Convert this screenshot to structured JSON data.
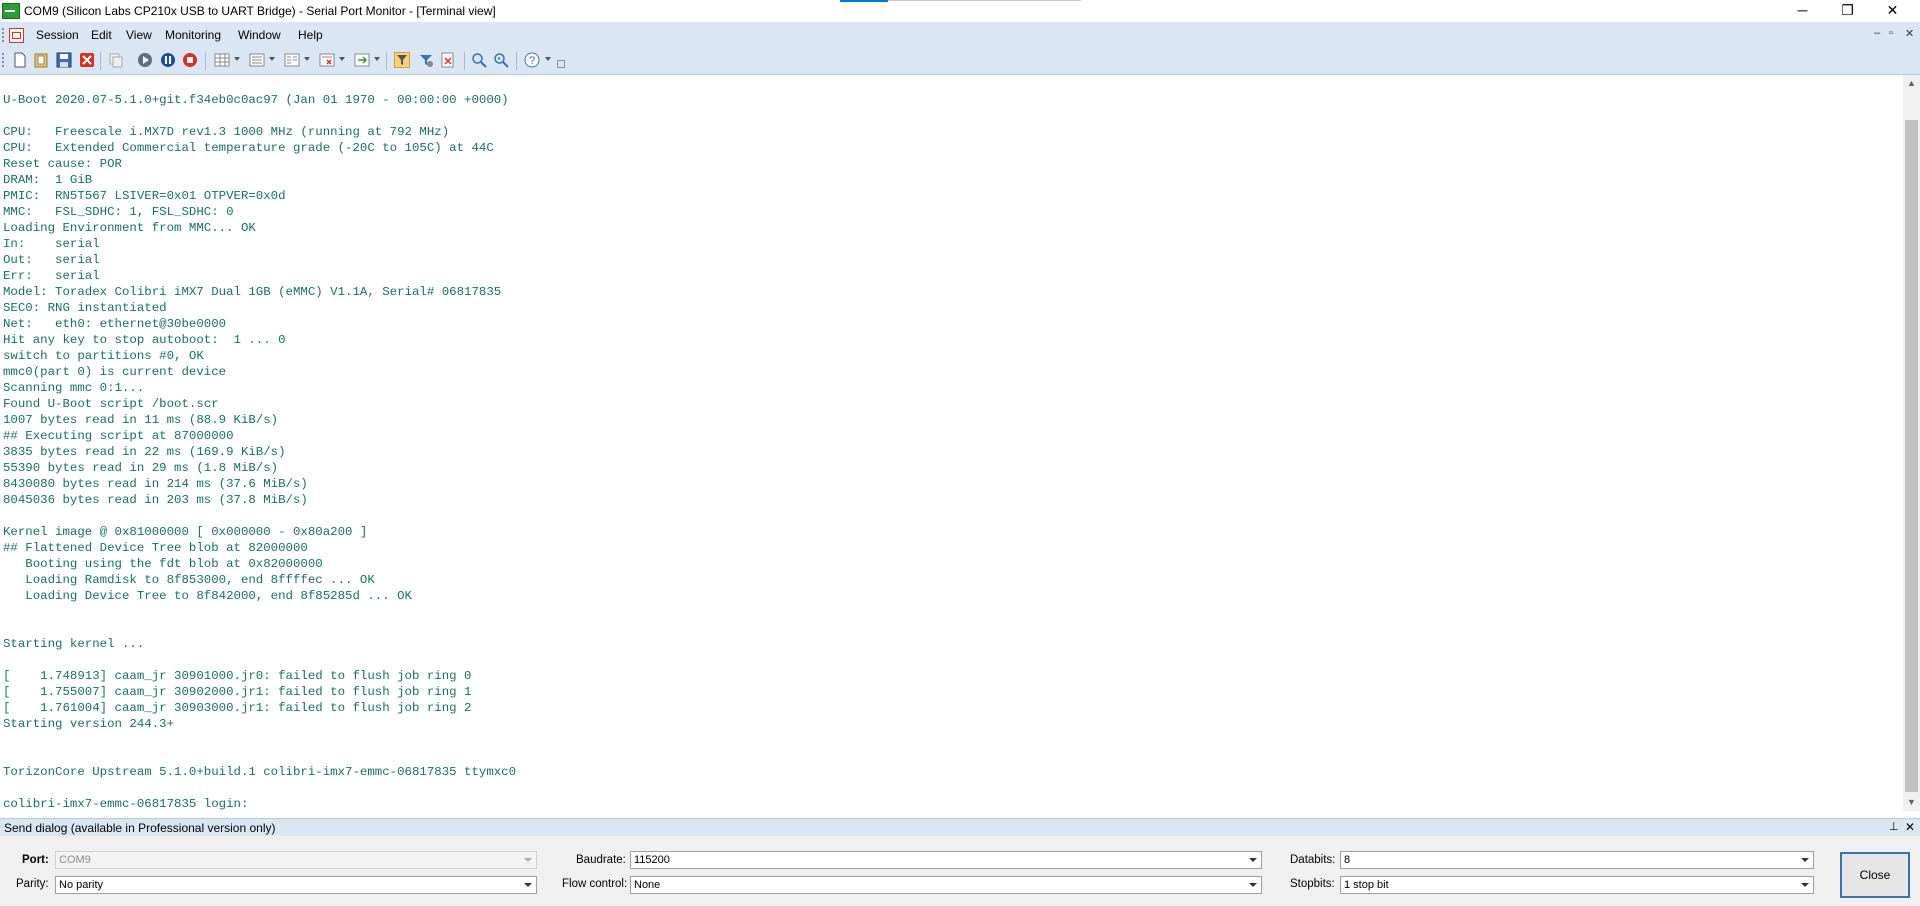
{
  "window": {
    "title": "COM9 (Silicon Labs CP210x USB to UART Bridge) - Serial Port Monitor - [Terminal view]",
    "controls": {
      "minimize": "─",
      "restore": "❐",
      "close": "✕"
    }
  },
  "menu": {
    "items": [
      "Session",
      "Edit",
      "View",
      "Monitoring",
      "Window",
      "Help"
    ],
    "mdi_controls": {
      "minimize": "‒",
      "restore": "▫",
      "close": "✕"
    }
  },
  "toolbar": {
    "buttons": [
      "new-session-icon",
      "open-session-icon",
      "save-icon",
      "close-session-icon",
      "copy-icon",
      "start-monitoring-icon",
      "pause-icon",
      "stop-icon",
      "table-view-icon",
      "line-view-icon",
      "dump-view-icon",
      "terminal-view-icon",
      "export-icon",
      "filter-icon",
      "settings-icon",
      "clear-icon",
      "find-icon",
      "find-next-icon",
      "help-icon"
    ]
  },
  "terminal": {
    "lines": [
      "U-Boot 2020.07-5.1.0+git.f34eb0c0ac97 (Jan 01 1970 - 00:00:00 +0000)",
      "",
      "CPU:   Freescale i.MX7D rev1.3 1000 MHz (running at 792 MHz)",
      "CPU:   Extended Commercial temperature grade (-20C to 105C) at 44C",
      "Reset cause: POR",
      "DRAM:  1 GiB",
      "PMIC:  RN5T567 LSIVER=0x01 OTPVER=0x0d",
      "MMC:   FSL_SDHC: 1, FSL_SDHC: 0",
      "Loading Environment from MMC... OK",
      "In:    serial",
      "Out:   serial",
      "Err:   serial",
      "Model: Toradex Colibri iMX7 Dual 1GB (eMMC) V1.1A, Serial# 06817835",
      "SEC0: RNG instantiated",
      "Net:   eth0: ethernet@30be0000",
      "Hit any key to stop autoboot:  1 ... 0",
      "switch to partitions #0, OK",
      "mmc0(part 0) is current device",
      "Scanning mmc 0:1...",
      "Found U-Boot script /boot.scr",
      "1007 bytes read in 11 ms (88.9 KiB/s)",
      "## Executing script at 87000000",
      "3835 bytes read in 22 ms (169.9 KiB/s)",
      "55390 bytes read in 29 ms (1.8 MiB/s)",
      "8430080 bytes read in 214 ms (37.6 MiB/s)",
      "8045036 bytes read in 203 ms (37.8 MiB/s)",
      "",
      "Kernel image @ 0x81000000 [ 0x000000 - 0x80a200 ]",
      "## Flattened Device Tree blob at 82000000",
      "   Booting using the fdt blob at 0x82000000",
      "   Loading Ramdisk to 8f853000, end 8ffffec ... OK",
      "   Loading Device Tree to 8f842000, end 8f85285d ... OK",
      "",
      "",
      "Starting kernel ...",
      "",
      "[    1.748913] caam_jr 30901000.jr0: failed to flush job ring 0",
      "[    1.755007] caam_jr 30902000.jr1: failed to flush job ring 1",
      "[    1.761004] caam_jr 30903000.jr1: failed to flush job ring 2",
      "Starting version 244.3+",
      "",
      "",
      "TorizonCore Upstream 5.1.0+build.1 colibri-imx7-emmc-06817835 ttymxc0",
      "",
      "colibri-imx7-emmc-06817835 login:"
    ]
  },
  "send_dialog": {
    "title": "Send dialog (available in Professional version only)",
    "pin": "⊥",
    "close": "✕",
    "port_label": "Port:",
    "port_value": "COM9",
    "parity_label": "Parity:",
    "parity_value": "No parity",
    "baudrate_label": "Baudrate:",
    "baudrate_value": "115200",
    "flow_label": "Flow control:",
    "flow_value": "None",
    "databits_label": "Databits:",
    "databits_value": "8",
    "stopbits_label": "Stopbits:",
    "stopbits_value": "1 stop bit",
    "close_button": "Close"
  }
}
